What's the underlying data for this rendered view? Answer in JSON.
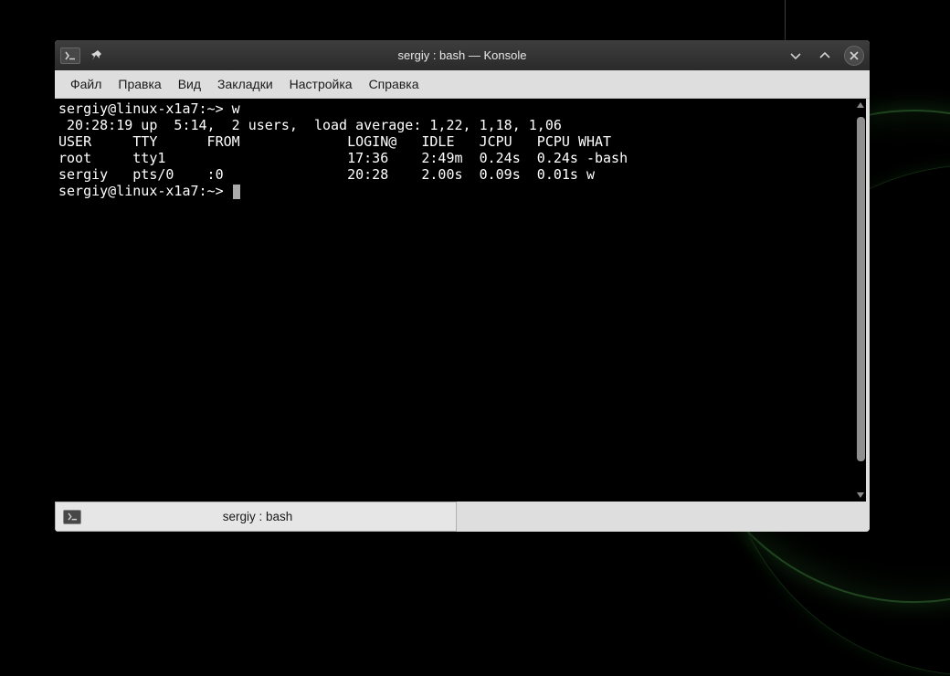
{
  "window": {
    "title": "sergiy : bash — Konsole"
  },
  "menubar": {
    "file": "Файл",
    "edit": "Правка",
    "view": "Вид",
    "bookmarks": "Закладки",
    "settings": "Настройка",
    "help": "Справка"
  },
  "terminal": {
    "prompt1": "sergiy@linux-x1a7:~> ",
    "command1": "w",
    "line2": " 20:28:19 up  5:14,  2 users,  load average: 1,22, 1,18, 1,06",
    "header": "USER     TTY      FROM             LOGIN@   IDLE   JCPU   PCPU WHAT",
    "row1": "root     tty1                      17:36    2:49m  0.24s  0.24s -bash",
    "row2": "sergiy   pts/0    :0               20:28    2.00s  0.09s  0.01s w",
    "prompt2": "sergiy@linux-x1a7:~> "
  },
  "tab": {
    "label": "sergiy : bash"
  }
}
